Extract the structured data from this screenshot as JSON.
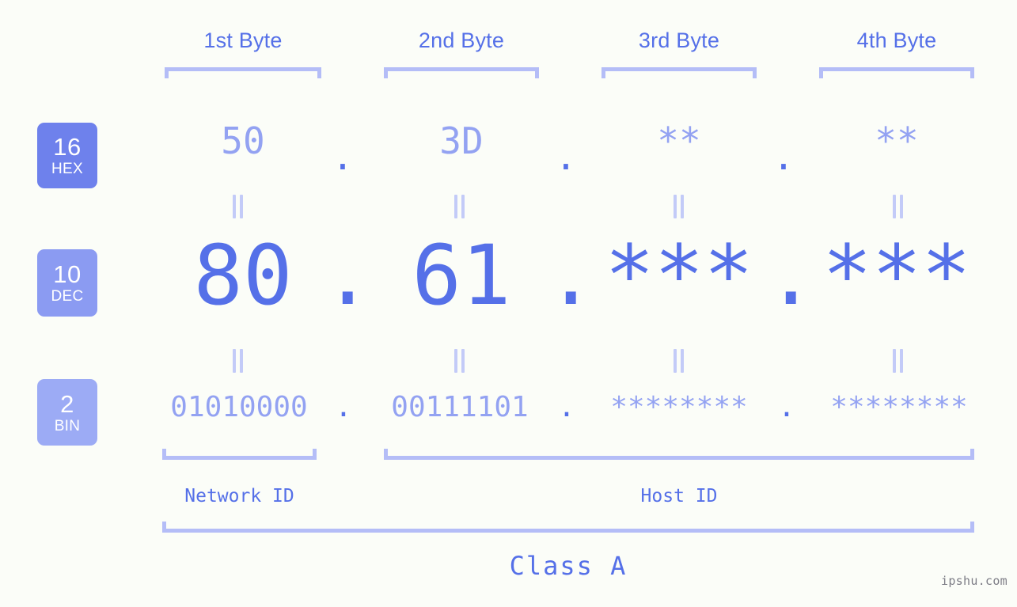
{
  "background_color": "#fbfdf8",
  "colors": {
    "accent_strong": "#5570e8",
    "accent_light": "#93a2f2",
    "bracket": "#b4bdf7",
    "equals": "#c3cbf8",
    "badge_hex": "#6e81ec",
    "badge_dec": "#8b9bf2",
    "badge_bin": "#9cabf5",
    "watermark": "#7d7d86"
  },
  "byte_headers": [
    {
      "label": "1st Byte"
    },
    {
      "label": "2nd Byte"
    },
    {
      "label": "3rd Byte"
    },
    {
      "label": "4th Byte"
    }
  ],
  "rows": {
    "hex": {
      "badge_number": "16",
      "badge_unit": "HEX",
      "values": [
        "50",
        "3D",
        "**",
        "**"
      ],
      "separator": "."
    },
    "dec": {
      "badge_number": "10",
      "badge_unit": "DEC",
      "values": [
        "80",
        "61",
        "***",
        "***"
      ],
      "separator": "."
    },
    "bin": {
      "badge_number": "2",
      "badge_unit": "BIN",
      "values": [
        "01010000",
        "00111101",
        "********",
        "********"
      ],
      "separator": "."
    }
  },
  "id_sections": [
    {
      "label": "Network ID"
    },
    {
      "label": "Host ID"
    }
  ],
  "class_label": "Class A",
  "watermark": "ipshu.com"
}
